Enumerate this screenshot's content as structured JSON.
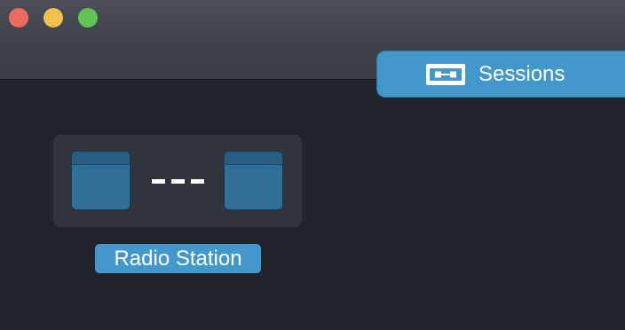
{
  "window": {
    "controls": [
      "close",
      "minimize",
      "maximize"
    ],
    "colors": {
      "background": "#21242c",
      "accent": "#4297cb",
      "close": "#ed6a5e",
      "minimize": "#f5bf4f",
      "maximize": "#61c554"
    }
  },
  "tabs": [
    {
      "label": "Sessions",
      "icon": "sessions-icon",
      "active": true
    }
  ],
  "sessions": [
    {
      "label": "Radio Station",
      "icon_left": "panel-window-icon",
      "icon_right": "panel-window-icon",
      "connector": "dashed-link"
    }
  ]
}
